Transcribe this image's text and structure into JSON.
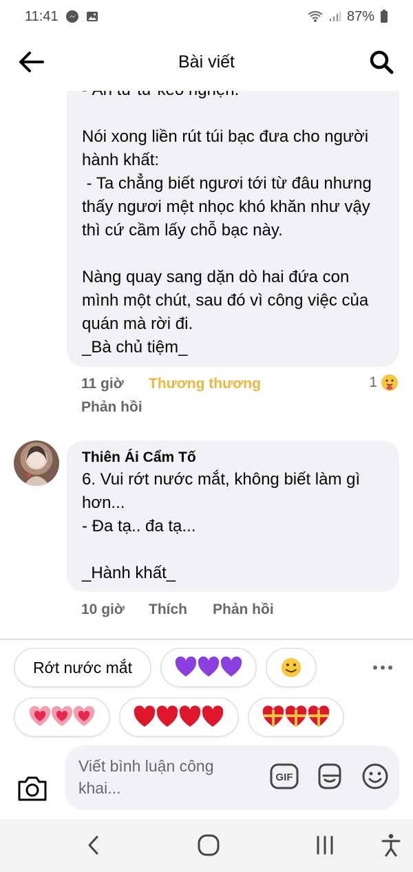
{
  "status_bar": {
    "time": "11:41",
    "battery": "87%"
  },
  "header": {
    "title": "Bài viết"
  },
  "comments": [
    {
      "text": "- Ăn từ từ kẻo nghẹn.\n\nNói xong liền rút túi bạc đưa cho người hành khất:\n - Ta chẳng biết ngươi tới từ đâu nhưng thấy ngươi mệt nhọc khó khăn như vậy thì cứ cầm lấy chỗ bạc này.\n\nNàng quay sang dặn dò hai đứa con mình một chút, sau đó vì công việc của quán mà rời đi.\n_Bà chủ tiệm_",
      "time": "11 giờ",
      "reaction_label": "Thương thương",
      "reply_label": "Phản hồi",
      "reaction_count": "1",
      "reaction_icon": "care-reaction-icon"
    },
    {
      "author": "Thiên Ái Cẩm Tố",
      "text": "6. Vui rớt nước mắt, không biết làm gì hơn...\n- Đa tạ.. đa tạ...\n\n_Hành khất_",
      "time": "10 giờ",
      "like_label": "Thích",
      "reply_label": "Phản hồi"
    }
  ],
  "quick_replies": {
    "row1": [
      "Rớt nước mắt",
      "💜💜💜",
      "🙂"
    ],
    "row2": [
      "💗💗💗",
      "❤️❤️❤️❤️",
      "💝💝💝"
    ]
  },
  "composer": {
    "placeholder": "Viết bình luận công khai..."
  },
  "colors": {
    "bubble": "#f0f2f5",
    "reacted": "#f0b53a",
    "meta": "#65676b"
  }
}
